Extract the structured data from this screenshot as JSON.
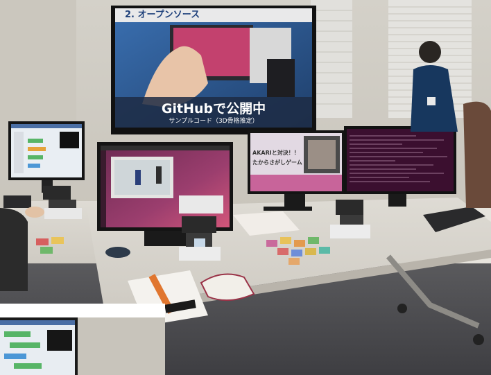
{
  "photo": {
    "kind": "event-booth-photo"
  },
  "big_display": {
    "header_text": "2. オープンソース",
    "headline": "GitHubで公開中",
    "subline": "サンプルコード（3D骨格推定）"
  },
  "center_right_monitor": {
    "title_line1": "AKARIと対決！！",
    "title_line2": "たからさがしゲーム"
  },
  "colors": {
    "ubuntu_purple": "#5b2648",
    "ubuntu_orange": "#e2592b",
    "table_top": "#dddad3",
    "wall": "#d6d3cc",
    "slide_blue": "#2c5f9e"
  },
  "icons": [
    "robot-icon",
    "mouse-icon",
    "keyboard-icon"
  ]
}
